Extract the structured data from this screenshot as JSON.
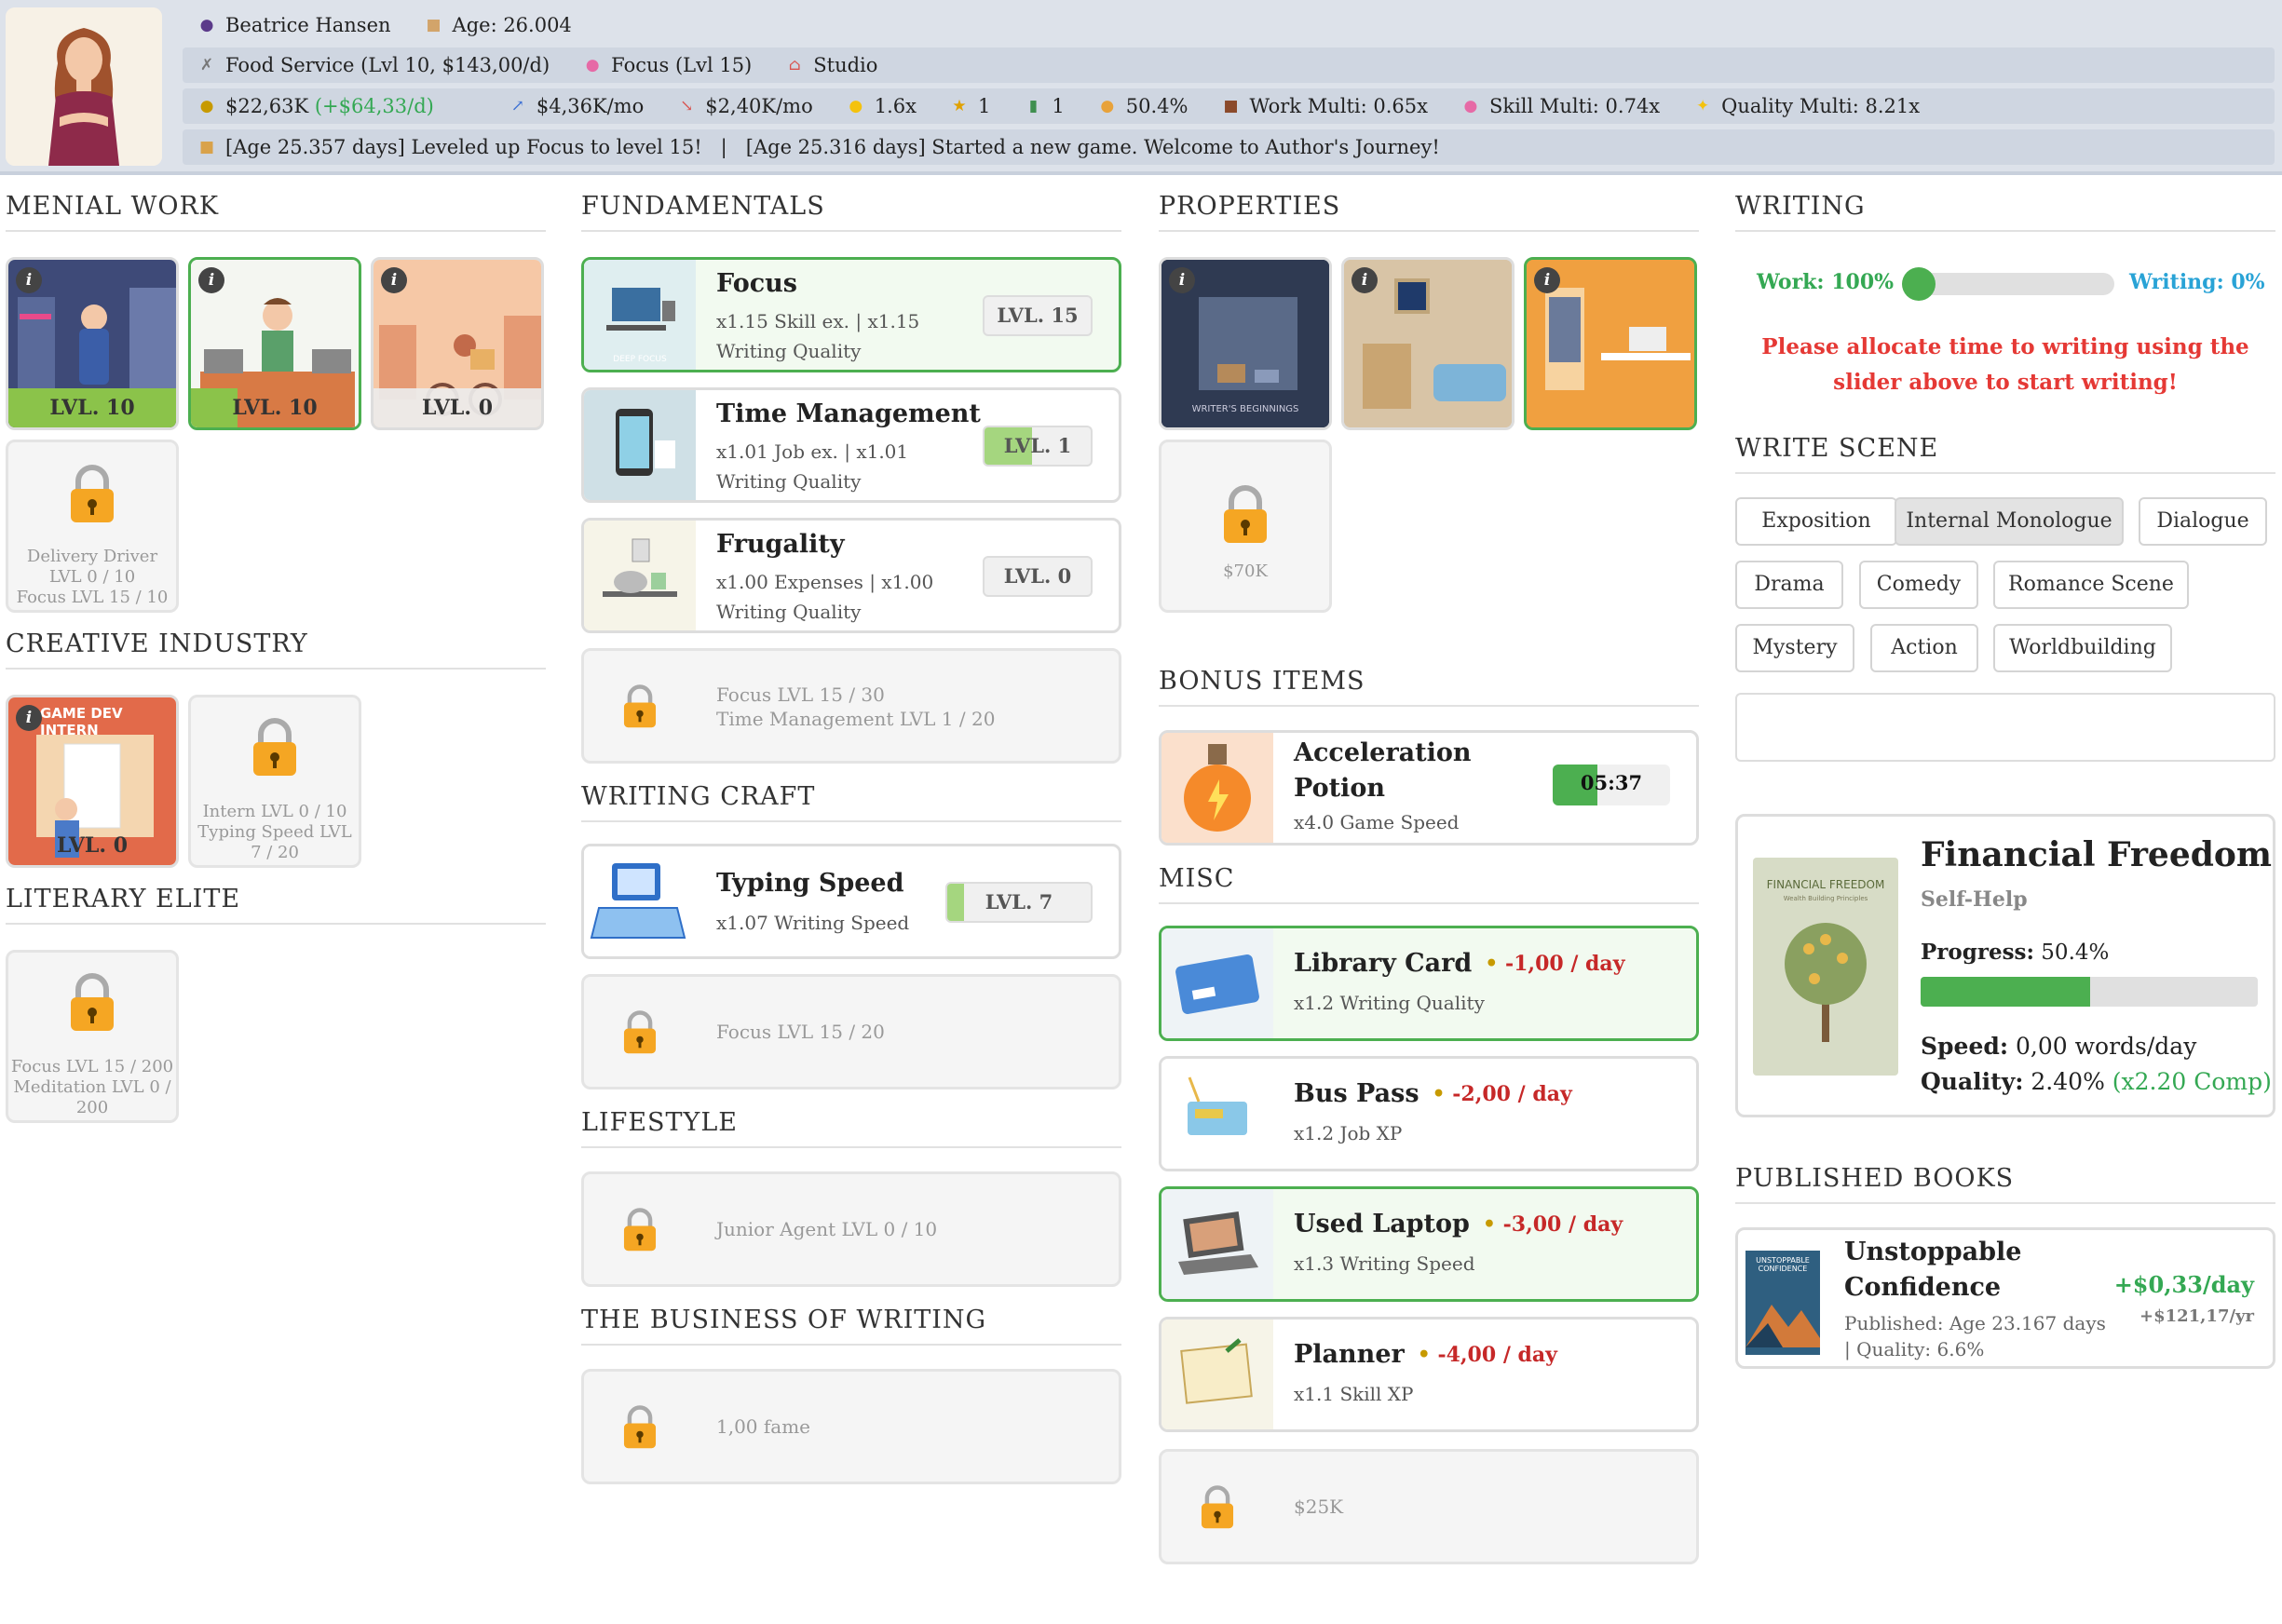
{
  "header": {
    "name": "Beatrice Hansen",
    "age": "Age: 26.004",
    "job": "Food Service (Lvl 10, $143,00/d)",
    "skill": "Focus (Lvl 15)",
    "home": "Studio",
    "money": "$22,63K",
    "money_rate": "(+$64,33/d)",
    "income": "$4,36K/mo",
    "expense": "$2,40K/mo",
    "ideas": "1.6x",
    "awards": "1",
    "books": "1",
    "progress": "50.4%",
    "work_multi": "Work Multi: 0.65x",
    "skill_multi": "Skill Multi: 0.74x",
    "quality_multi": "Quality Multi: 8.21x",
    "log": "[Age 25.357 days] Leveled up Focus to level 15!   |   [Age 25.316 days] Started a new game. Welcome to Author's Journey!"
  },
  "menial": {
    "title": "MENIAL WORK",
    "tiles": [
      {
        "level": "LVL. 10",
        "progress": 1.0
      },
      {
        "level": "LVL. 10",
        "progress": 0.28
      },
      {
        "level": "LVL. 0",
        "progress": 0
      }
    ],
    "locked": {
      "line1": "Delivery Driver",
      "line2": "LVL 0 / 10",
      "line3": "Focus LVL 15 / 10"
    }
  },
  "creative": {
    "title": "CREATIVE INDUSTRY",
    "tile": {
      "banner": "GAME DEV INTERN",
      "level": "LVL. 0",
      "progress": 0
    },
    "locked": {
      "line1": "Intern LVL 0 / 10",
      "line2": "Typing Speed LVL",
      "line3": "7 / 20"
    }
  },
  "literary": {
    "title": "LITERARY ELITE",
    "locked": {
      "line1": "Focus LVL 15 / 200",
      "line2": "Meditation LVL 0 /",
      "line3": "200"
    }
  },
  "fundamentals": {
    "title": "FUNDAMENTALS",
    "items": [
      {
        "name": "Focus",
        "line1": "x1.15 Skill ex. | x1.15",
        "line2": "Writing Quality",
        "level": "LVL. 15",
        "progress": 0.0,
        "img_label": "DEEP FOCUS"
      },
      {
        "name": "Time Management",
        "line1": "x1.01 Job ex. | x1.01",
        "line2": "Writing Quality",
        "level": "LVL. 1",
        "progress": 0.45
      },
      {
        "name": "Frugality",
        "line1": "x1.00 Expenses | x1.00",
        "line2": "Writing Quality",
        "level": "LVL. 0",
        "progress": 0
      }
    ],
    "locked": {
      "line1": "Focus LVL 15 / 30",
      "line2": "Time Management LVL 1 / 20"
    }
  },
  "writing_craft": {
    "title": "WRITING CRAFT",
    "item": {
      "name": "Typing Speed",
      "line1": "x1.07 Writing Speed",
      "level": "LVL. 7",
      "progress": 0.12
    },
    "locked": {
      "line1": "Focus LVL 15 / 20"
    }
  },
  "lifestyle": {
    "title": "LIFESTYLE",
    "locked": {
      "line1": "Junior Agent LVL 0 / 10"
    }
  },
  "business": {
    "title": "THE BUSINESS OF WRITING",
    "locked": {
      "line1": "1,00 fame"
    }
  },
  "properties": {
    "title": "PROPERTIES",
    "tile1_label": "WRITER'S BEGINNINGS",
    "locked_price": "$70K"
  },
  "bonus": {
    "title": "BONUS ITEMS",
    "potion": {
      "name1": "Acceleration",
      "name2": "Potion",
      "desc": "x4.0 Game Speed",
      "timer": "05:37",
      "progress": 0.38
    }
  },
  "misc": {
    "title": "MISC",
    "items": [
      {
        "name": "Library Card",
        "dot": "•",
        "cost": "-1,00 / day",
        "desc": "x1.2 Writing Quality",
        "active": true
      },
      {
        "name": "Bus Pass",
        "dot": "•",
        "cost": "-2,00 / day",
        "desc": "x1.2 Job XP",
        "active": false
      },
      {
        "name": "Used Laptop",
        "dot": "•",
        "cost": "-3,00 / day",
        "desc": "x1.3 Writing Speed",
        "active": true
      },
      {
        "name": "Planner",
        "dot": "•",
        "cost": "-4,00 / day",
        "desc": "x1.1 Skill XP",
        "active": false
      }
    ],
    "locked_price": "$25K"
  },
  "writing": {
    "title": "WRITING",
    "work_label": "Work: 100%",
    "writing_label": "Writing: 0%",
    "slider_value": 0,
    "warning": "Please allocate time to writing using the slider above to start writing!"
  },
  "write_scene": {
    "title": "WRITE SCENE",
    "tags": [
      "Exposition",
      "Internal Monologue",
      "Dialogue",
      "Drama",
      "Comedy",
      "Romance Scene",
      "Mystery",
      "Action",
      "Worldbuilding"
    ],
    "selected": "Internal Monologue"
  },
  "current_book": {
    "title": "Financial Freedom",
    "genre": "Self-Help",
    "cover_title": "FINANCIAL FREEDOM",
    "cover_sub": "Wealth Building Principles",
    "progress_label": "Progress:",
    "progress_value": "50.4%",
    "progress": 0.504,
    "speed_label": "Speed:",
    "speed_value": "0,00 words/day",
    "quality_label": "Quality:",
    "quality_value": "2.40%",
    "quality_comp": "(x2.20 Comp)"
  },
  "published": {
    "title": "PUBLISHED BOOKS",
    "book": {
      "name1": "Unstoppable",
      "name2": "Confidence",
      "cover": "UNSTOPPABLE CONFIDENCE",
      "published": "Published: Age 23.167 days",
      "quality": "| Quality: 6.6%",
      "daily": "+$0,33/day",
      "yearly": "+$121,17/yr"
    }
  },
  "colors": {
    "accent_green": "#4caf50",
    "warning_red": "#e53935",
    "money_green": "#34a853"
  }
}
